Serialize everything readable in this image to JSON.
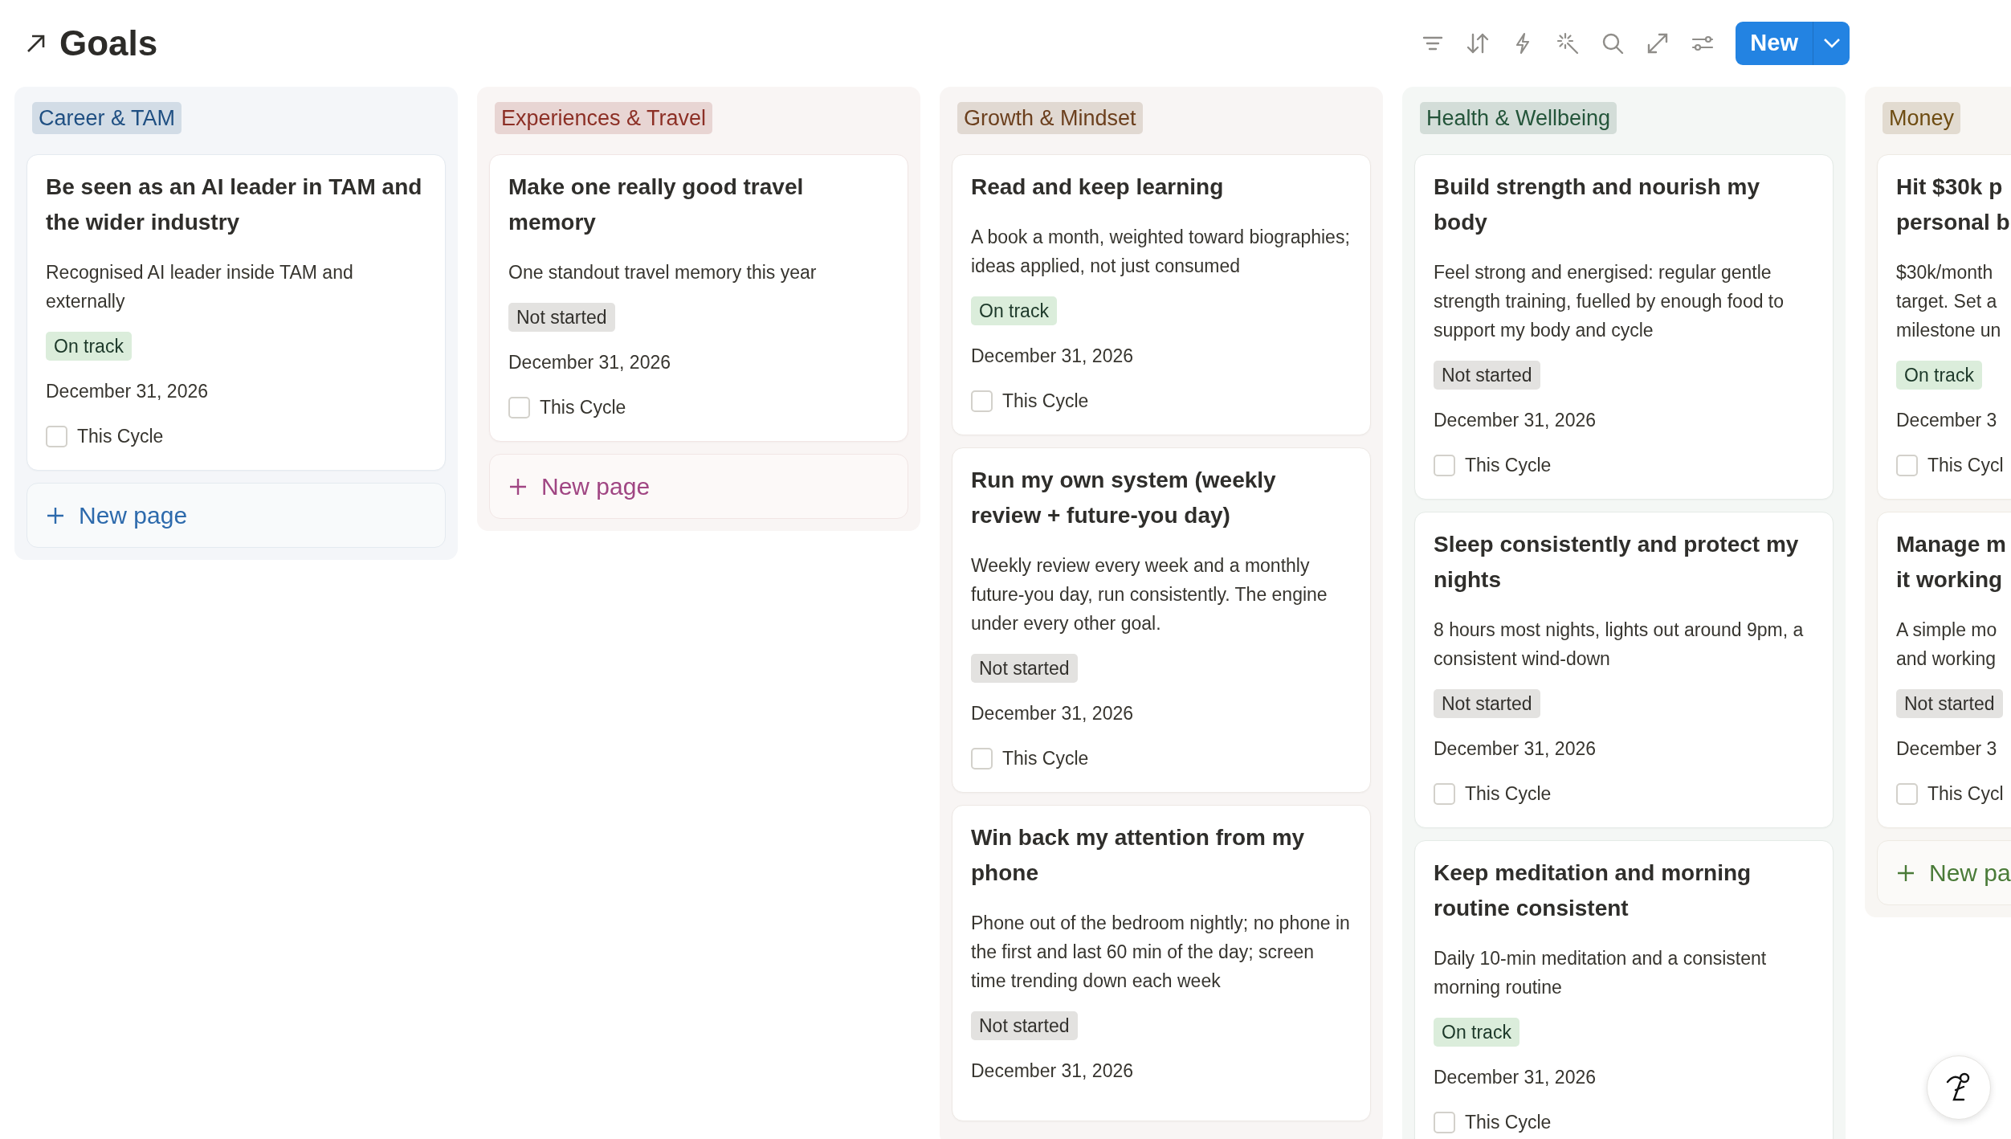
{
  "page": {
    "title": "Goals"
  },
  "toolbar": {
    "new_button": "New"
  },
  "columns": [
    {
      "name": "Career & TAM",
      "color": "#1f4f82",
      "new_page": "New page",
      "cards": [
        {
          "title": "Be seen as an AI leader in TAM and the wider industry",
          "description": "Recognised AI leader inside TAM and externally",
          "status": {
            "label": "On track",
            "kind": "on_track"
          },
          "date": "December 31, 2026",
          "cycle": {
            "label": "This Cycle",
            "checked": false
          }
        }
      ]
    },
    {
      "name": "Experiences & Travel",
      "color": "#8c2f25",
      "new_page": "New page",
      "cards": [
        {
          "title": "Make one really good travel memory",
          "description": "One standout travel memory this year",
          "status": {
            "label": "Not started",
            "kind": "not_started"
          },
          "date": "December 31, 2026",
          "cycle": {
            "label": "This Cycle",
            "checked": false
          }
        }
      ]
    },
    {
      "name": "Growth & Mindset",
      "color": "#6b3f1d",
      "cards": [
        {
          "title": "Read and keep learning",
          "description": "A book a month, weighted toward biographies; ideas applied, not just consumed",
          "status": {
            "label": "On track",
            "kind": "on_track"
          },
          "date": "December 31, 2026",
          "cycle": {
            "label": "This Cycle",
            "checked": false
          }
        },
        {
          "title": "Run my own system (weekly review + future-you day)",
          "description": "Weekly review every week and a monthly future-you day, run consistently. The engine under every other goal.",
          "status": {
            "label": "Not started",
            "kind": "not_started"
          },
          "date": "December 31, 2026",
          "cycle": {
            "label": "This Cycle",
            "checked": false
          }
        },
        {
          "title": "Win back my attention from my phone",
          "description": "Phone out of the bedroom nightly; no phone in the first and last 60 min of the day; screen time trending down each week",
          "status": {
            "label": "Not started",
            "kind": "not_started"
          },
          "date": "December 31, 2026"
        }
      ]
    },
    {
      "name": "Health & Wellbeing",
      "color": "#24553a",
      "cards": [
        {
          "title": "Build strength and nourish my body",
          "description": "Feel strong and energised: regular gentle strength training, fuelled by enough food to support my body and cycle",
          "status": {
            "label": "Not started",
            "kind": "not_started"
          },
          "date": "December 31, 2026",
          "cycle": {
            "label": "This Cycle",
            "checked": false
          }
        },
        {
          "title": "Sleep consistently and protect my nights",
          "description": "8 hours most nights, lights out around 9pm, a consistent wind-down",
          "status": {
            "label": "Not started",
            "kind": "not_started"
          },
          "date": "December 31, 2026",
          "cycle": {
            "label": "This Cycle",
            "checked": false
          }
        },
        {
          "title": "Keep meditation and morning routine consistent",
          "description": "Daily 10-min meditation and a consistent morning routine",
          "status": {
            "label": "On track",
            "kind": "on_track"
          },
          "date": "December 31, 2026",
          "cycle": {
            "label": "This Cycle",
            "checked": false
          }
        }
      ]
    },
    {
      "name": "Money",
      "color": "#6e4c12",
      "new_page": "New pa",
      "cards": [
        {
          "title": "Hit $30k p\npersonal b",
          "description": "$30k/month\ntarget. Set a\nmilestone un",
          "status": {
            "label": "On track",
            "kind": "on_track"
          },
          "date": "December 3",
          "cycle": {
            "label": "This Cycl",
            "checked": false
          }
        },
        {
          "title": "Manage m\nit working",
          "description": "A simple mo\nand working",
          "status": {
            "label": "Not started",
            "kind": "not_started"
          },
          "date": "December 3",
          "cycle": {
            "label": "This Cycl",
            "checked": false
          }
        }
      ]
    }
  ]
}
